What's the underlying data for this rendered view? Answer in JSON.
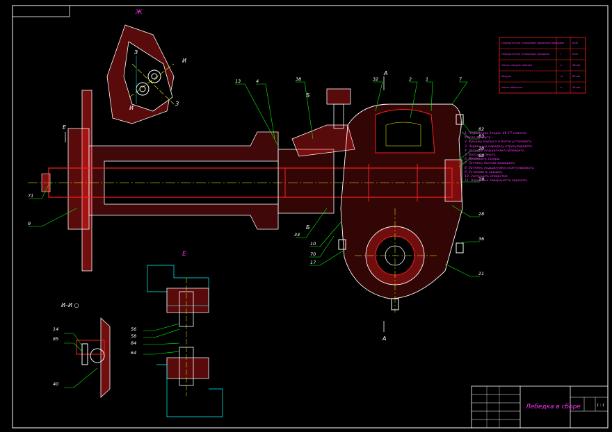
{
  "drawing": {
    "title_block": {
      "name": "Лебедка в сборе",
      "scale": "1 : 1"
    },
    "section_labels": {
      "view_zh": "Ж",
      "view_e_top": "Е",
      "view_e_bottom": "Е",
      "section_ii": "И–И ○",
      "cut_a_top": "А",
      "cut_a_bottom": "А",
      "cut_b_top": "Б",
      "cut_b_bottom": "Б",
      "cut_z1": "З",
      "cut_z2": "З",
      "cut_i1": "И",
      "cut_i2": "И"
    },
    "callouts": [
      {
        "id": "c-71",
        "text": "71"
      },
      {
        "id": "c-9",
        "text": "9"
      },
      {
        "id": "c-13",
        "text": "13"
      },
      {
        "id": "c-4",
        "text": "4"
      },
      {
        "id": "c-38",
        "text": "38"
      },
      {
        "id": "c-32",
        "text": "32"
      },
      {
        "id": "c-2",
        "text": "2"
      },
      {
        "id": "c-1",
        "text": "1"
      },
      {
        "id": "c-7",
        "text": "7"
      },
      {
        "id": "c-82",
        "text": "82"
      },
      {
        "id": "c-83",
        "text": "83"
      },
      {
        "id": "c-20",
        "text": "20"
      },
      {
        "id": "c-68",
        "text": "68"
      },
      {
        "id": "c-19",
        "text": "19"
      },
      {
        "id": "c-28",
        "text": "28"
      },
      {
        "id": "c-36",
        "text": "36"
      },
      {
        "id": "c-21",
        "text": "21"
      },
      {
        "id": "c-34",
        "text": "34"
      },
      {
        "id": "c-10",
        "text": "10"
      },
      {
        "id": "c-70",
        "text": "70"
      },
      {
        "id": "c-17",
        "text": "17"
      },
      {
        "id": "c-14",
        "text": "14"
      },
      {
        "id": "c-85",
        "text": "85"
      },
      {
        "id": "c-40",
        "text": "40"
      },
      {
        "id": "c-56",
        "text": "56"
      },
      {
        "id": "c-58",
        "text": "58"
      },
      {
        "id": "c-84",
        "text": "84"
      },
      {
        "id": "c-64",
        "text": "64"
      }
    ],
    "tech_table": [
      {
        "name": "Передаточное отношение червячной передачи",
        "code": "i",
        "value": "6,05"
      },
      {
        "name": "Передаточное отношение передачи",
        "code": "i",
        "value": "6,05"
      },
      {
        "name": "Число заходов червяка",
        "code": "z",
        "value": "40 мм"
      },
      {
        "name": "Модуль",
        "code": "m",
        "value": "90 мм"
      },
      {
        "name": "Число оборотов",
        "code": "n",
        "value": "30 мм"
      }
    ],
    "notes": [
      "1. Подшипник 1подш. 46-17 смазать.",
      "Масло по кругу...",
      "2. Крышку корпуса и болты установить.",
      "3. Червячную передачу отрегулировать.",
      "4. Затяжку подшипника проверить.",
      "5. Болты затянуть.",
      "6. Проверить зазоры.",
      "7. Затяжку болтов проверить.",
      "8. Затяжку подшипника отрегулировать.",
      "9. Установить крышку.",
      "10. Заглушить отверстия.",
      "11. Наружные поверхности окрасить."
    ]
  }
}
